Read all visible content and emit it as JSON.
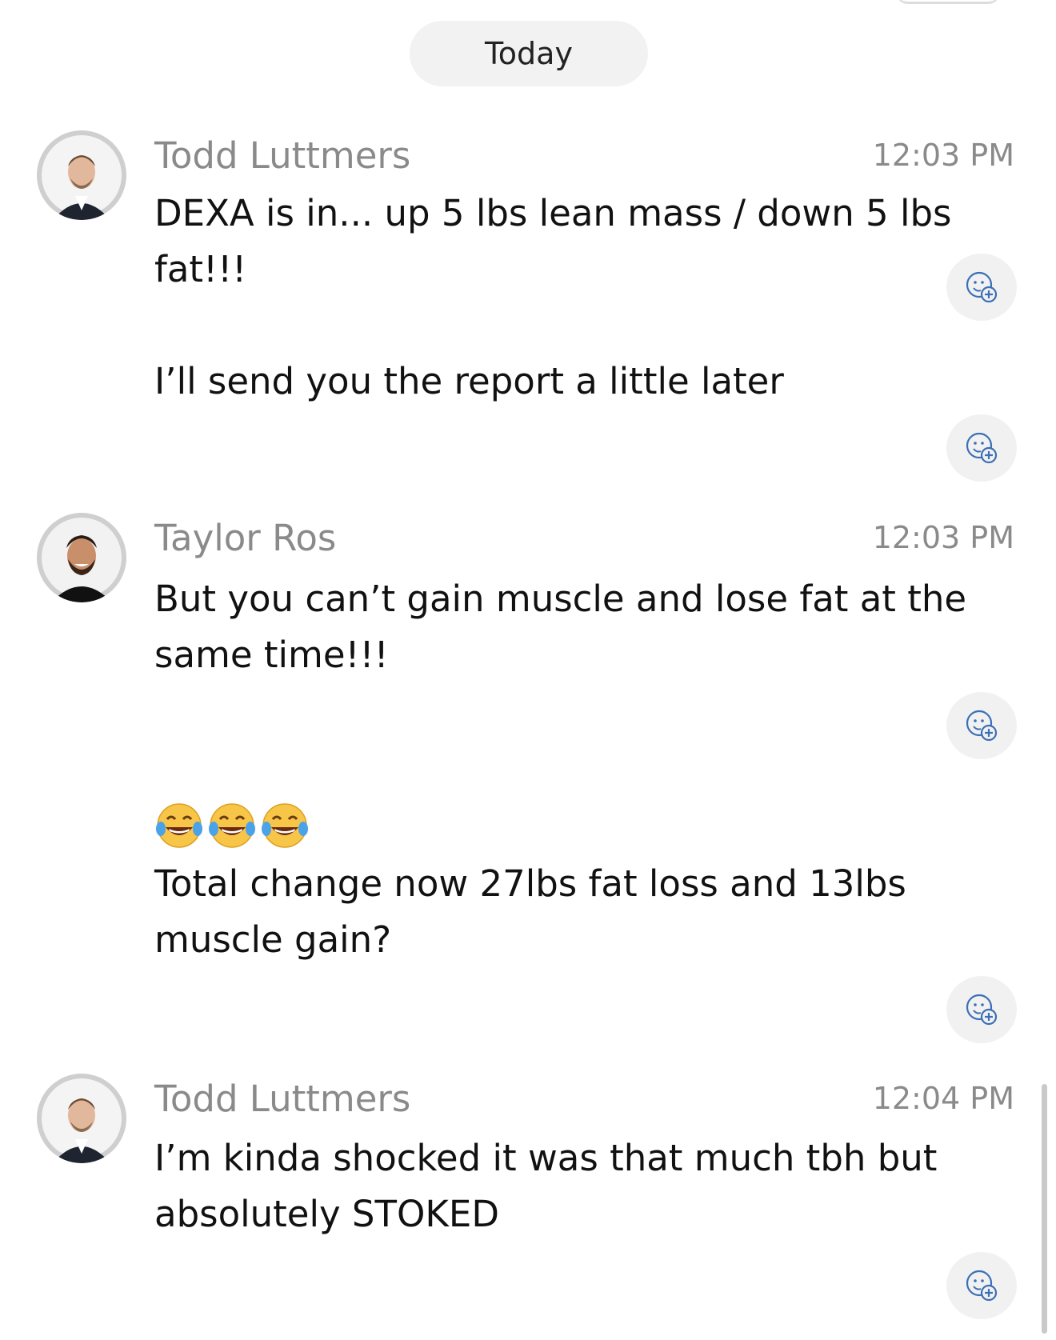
{
  "date_divider": "Today",
  "messages": [
    {
      "author": "Todd Luttmers",
      "time": "12:03 PM",
      "avatar": "todd-avatar",
      "text_1": "DEXA is in... up 5 lbs lean mass / down 5 lbs fat!!!",
      "text_2": "I’ll send you the report a little later"
    },
    {
      "author": "Taylor Ros",
      "time": "12:03 PM",
      "avatar": "taylor-avatar",
      "text_1": "But you can’t gain muscle and lose fat at the same time!!!",
      "emoji": "😂😂😂",
      "text_2": "Total change now 27lbs fat loss and 13lbs muscle gain?"
    },
    {
      "author": "Todd Luttmers",
      "time": "12:04 PM",
      "avatar": "todd-avatar",
      "text_1": "I’m kinda shocked it was that much tbh but absolutely STOKED"
    }
  ],
  "icons": {
    "reaction": "add-reaction-icon"
  },
  "colors": {
    "accent_icon": "#3b6fb6",
    "muted_text": "#8a8a8a",
    "pill_bg": "#f2f2f2"
  }
}
